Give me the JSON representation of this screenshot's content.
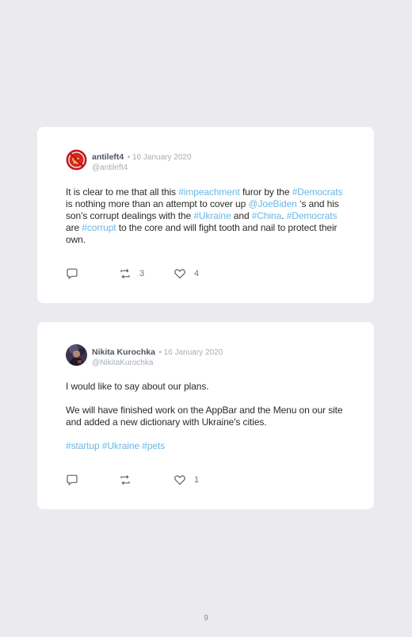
{
  "posts": [
    {
      "author": "antileft4",
      "date": "• 16 January 2020",
      "handle": "@antileft4",
      "avatar_icon": "no-hammer-sickle-icon",
      "body": [
        {
          "t": "It is clear to me that all this "
        },
        {
          "t": "#impeachment",
          "tag": true
        },
        {
          "t": " furor by the "
        },
        {
          "t": "#Democrats",
          "tag": true
        },
        {
          "t": " is nothing more than an attempt to cover up "
        },
        {
          "t": "@JoeBiden",
          "tag": true
        },
        {
          "t": " ‘s and his son’s corrupt dealings with the "
        },
        {
          "t": "#Ukraine",
          "tag": true
        },
        {
          "t": " and "
        },
        {
          "t": "#China",
          "tag": true
        },
        {
          "t": ". "
        },
        {
          "t": "#Democrats",
          "tag": true
        },
        {
          "t": " are "
        },
        {
          "t": "#corrupt",
          "tag": true
        },
        {
          "t": " to the core and will fight tooth and nail to protect their own."
        }
      ],
      "retweets": "3",
      "likes": "4"
    },
    {
      "author": "Nikita Kurochka",
      "date": "• 16 January 2020",
      "handle": "@NikitaKurochka",
      "avatar_icon": "user-photo-avatar",
      "line1": "I would like to say about our plans.",
      "line2": "We will have finished work on the AppBar and the Menu on our site and added a new dictionary with Ukraine's cities.",
      "tags": [
        "#startup",
        "#Ukraine",
        "#pets"
      ],
      "likes": "1"
    }
  ],
  "page_number": "9",
  "colors": {
    "background": "#ebebef",
    "card": "#ffffff",
    "hashtag": "#6ab7e6",
    "name": "#4d5563",
    "muted": "#a9adb4"
  }
}
